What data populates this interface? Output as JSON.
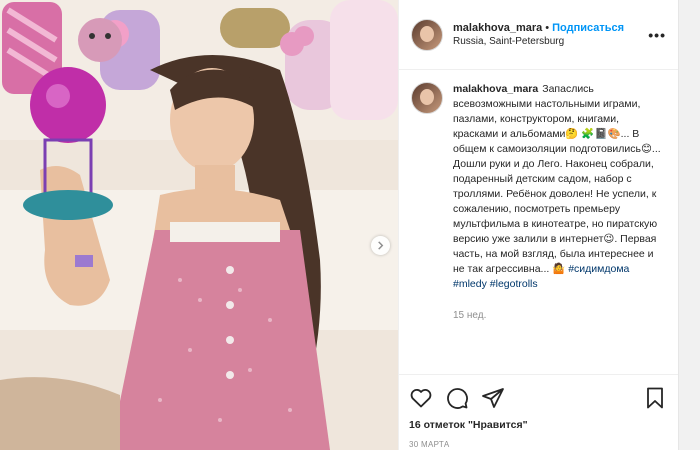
{
  "post": {
    "username": "malakhova_mara",
    "separator": "•",
    "follow_label": "Подписаться",
    "location": "Russia, Saint-Petersburg",
    "more_label": "•••"
  },
  "caption": {
    "username": "malakhova_mara",
    "text_1": "Запаслись всевозможными настольными играми, пазлами, конструктором, книгами, красками и альбомами🤔",
    "text_2": "🧩📓🎨... В общем к самоизоляции подготовились😊... Дошли руки и до Лего. Наконец собрали, подаренный детским садом, набор с троллями. Ребёнок доволен! Не успели, к сожалению, посмотреть премьеру мультфильма в кинотеатре, но пиратскую версию уже залили в интернет😉. Первая часть, на мой взгляд, была интереснее и не так агрессивна... 🤷",
    "hashtags": [
      "#сидимдома",
      "#mledy",
      "#legotrolls"
    ],
    "time": "15 нед."
  },
  "footer": {
    "likes": "16 отметок \"Нравится\"",
    "date": "30 МАРТА"
  },
  "icons": {
    "like": "heart-icon",
    "comment": "comment-icon",
    "share": "share-icon",
    "save": "bookmark-icon",
    "next": "chevron-right-icon"
  },
  "colors": {
    "follow": "#0095f6",
    "hashtag": "#00376b",
    "muted": "#8e8e8e",
    "text": "#262626"
  }
}
